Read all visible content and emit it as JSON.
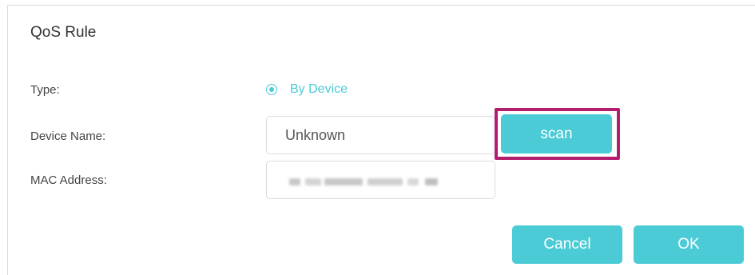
{
  "dialog": {
    "title": "QoS Rule"
  },
  "form": {
    "type_label": "Type:",
    "type_option": "By Device",
    "type_selected": true,
    "device_name_label": "Device Name:",
    "device_name_value": "Unknown",
    "mac_label": "MAC Address:",
    "mac_value_obscured": true
  },
  "buttons": {
    "scan": "scan",
    "cancel": "Cancel",
    "ok": "OK"
  },
  "colors": {
    "accent": "#4acbd6",
    "highlight": "#b31d6e"
  }
}
